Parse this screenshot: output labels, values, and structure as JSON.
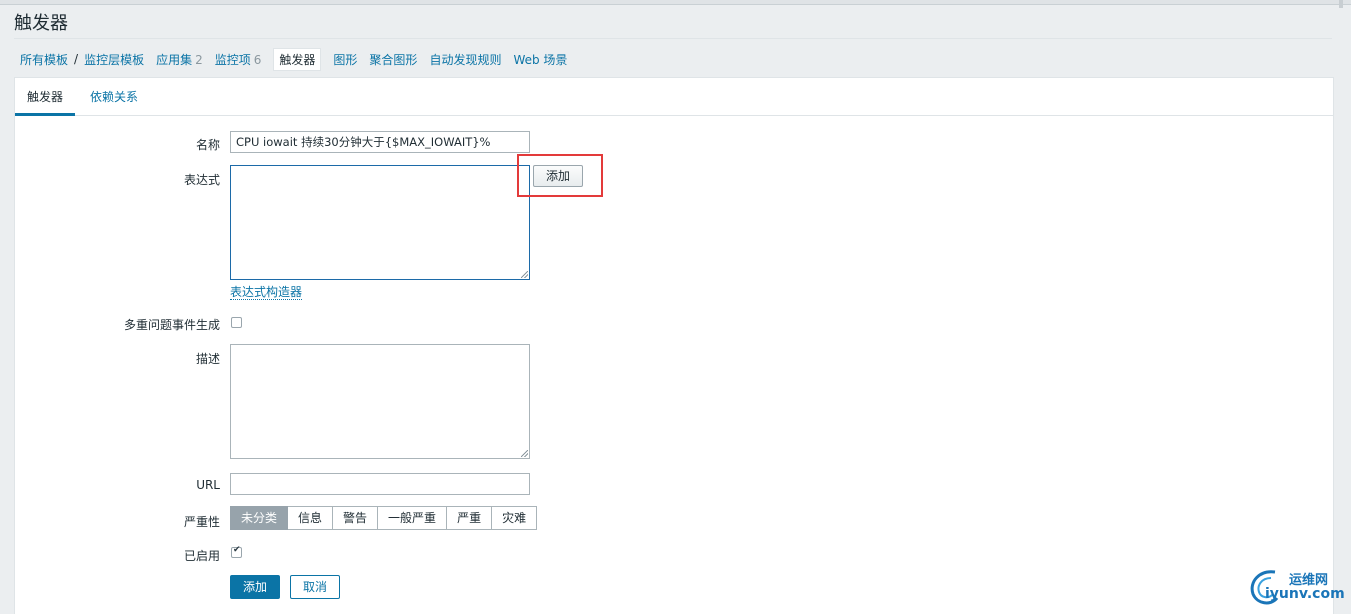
{
  "page": {
    "title": "触发器"
  },
  "breadcrumbs": {
    "all_templates": "所有模板",
    "separator": "/",
    "template": "监控层模板",
    "applications": "应用集",
    "applications_count": "2",
    "items": "监控项",
    "items_count": "6",
    "triggers": "触发器",
    "graphs": "图形",
    "screens": "聚合图形",
    "discovery": "自动发现规则",
    "web": "Web 场景"
  },
  "tabs": {
    "trigger": "触发器",
    "dependencies": "依赖关系"
  },
  "form": {
    "name_label": "名称",
    "name_value": "CPU iowait 持续30分钟大于{$MAX_IOWAIT}%",
    "expression_label": "表达式",
    "add_button": "添加",
    "expression_builder": "表达式构造器",
    "multiple_events_label": "多重问题事件生成",
    "description_label": "描述",
    "url_label": "URL",
    "url_value": "",
    "severity_label": "严重性",
    "severities": [
      "未分类",
      "信息",
      "警告",
      "一般严重",
      "严重",
      "灾难"
    ],
    "selected_severity": "未分类",
    "enabled_label": "已启用",
    "enabled": true,
    "submit_button": "添加",
    "cancel_button": "取消"
  },
  "watermark": {
    "line1": "运维网",
    "line2": "iyunv.com"
  },
  "colors": {
    "accent": "#0b74a6",
    "highlight": "#e33a3a",
    "severity_selected": "#97a3ab"
  }
}
